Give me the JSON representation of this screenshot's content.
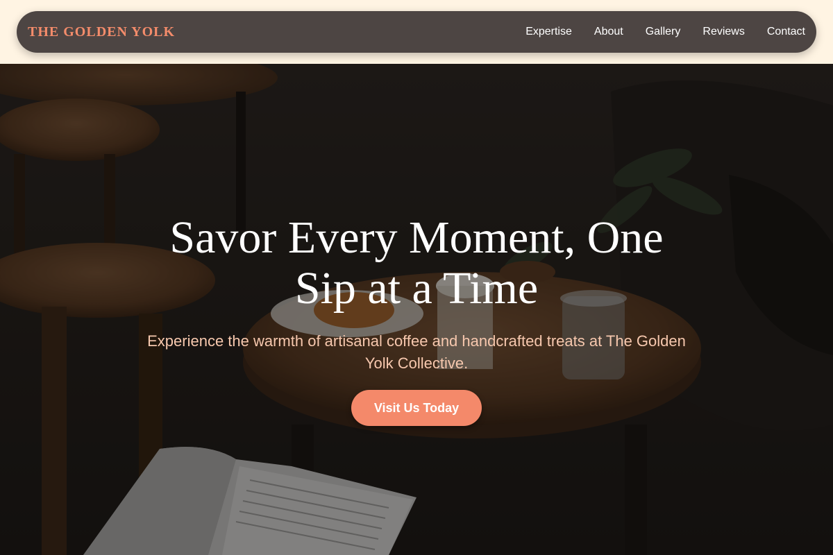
{
  "brand": {
    "name": "THE GOLDEN YOLK",
    "color": "#f48c6b"
  },
  "nav": {
    "links": [
      "Expertise",
      "About",
      "Gallery",
      "Reviews",
      "Contact"
    ]
  },
  "hero": {
    "headline": "Savor Every Moment, One Sip at a Time",
    "subtitle": "Experience the warmth of artisanal coffee and handcrafted treats at The Golden Yolk Collective.",
    "cta_label": "Visit Us Today",
    "cta_color": "#f4896a",
    "background": "dark cafe interior with wooden stools, round wooden table, coffee, croissant, water glass and open book"
  },
  "colors": {
    "page_bg": "#fff4e3",
    "nav_bg": "#4d4543",
    "subtitle": "#f7c8ae"
  }
}
